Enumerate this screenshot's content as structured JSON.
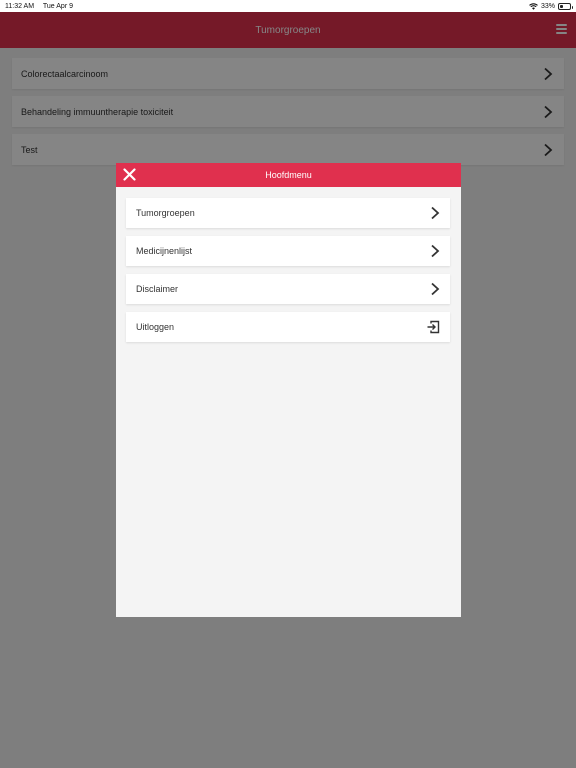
{
  "status_bar": {
    "time": "11:32 AM",
    "date": "Tue Apr 9",
    "battery": "33%",
    "battery_level": 0.33
  },
  "header": {
    "title": "Tumorgroepen"
  },
  "list": {
    "items": [
      {
        "label": "Colorectaalcarcinoom"
      },
      {
        "label": "Behandeling immuuntherapie toxiciteit"
      },
      {
        "label": "Test"
      }
    ]
  },
  "modal": {
    "title": "Hoofdmenu",
    "items": [
      {
        "label": "Tumorgroepen"
      },
      {
        "label": "Medicijnenlijst"
      },
      {
        "label": "Disclaimer"
      },
      {
        "label": "Uitloggen"
      }
    ]
  },
  "colors": {
    "accent": "#e0304e",
    "overlay": "#000000"
  },
  "icons": {
    "menu": "hamburger-menu-icon",
    "close": "close-icon",
    "chevron": "chevron-right-icon",
    "logout": "logout-icon",
    "wifi": "wifi-icon",
    "battery": "battery-icon"
  }
}
